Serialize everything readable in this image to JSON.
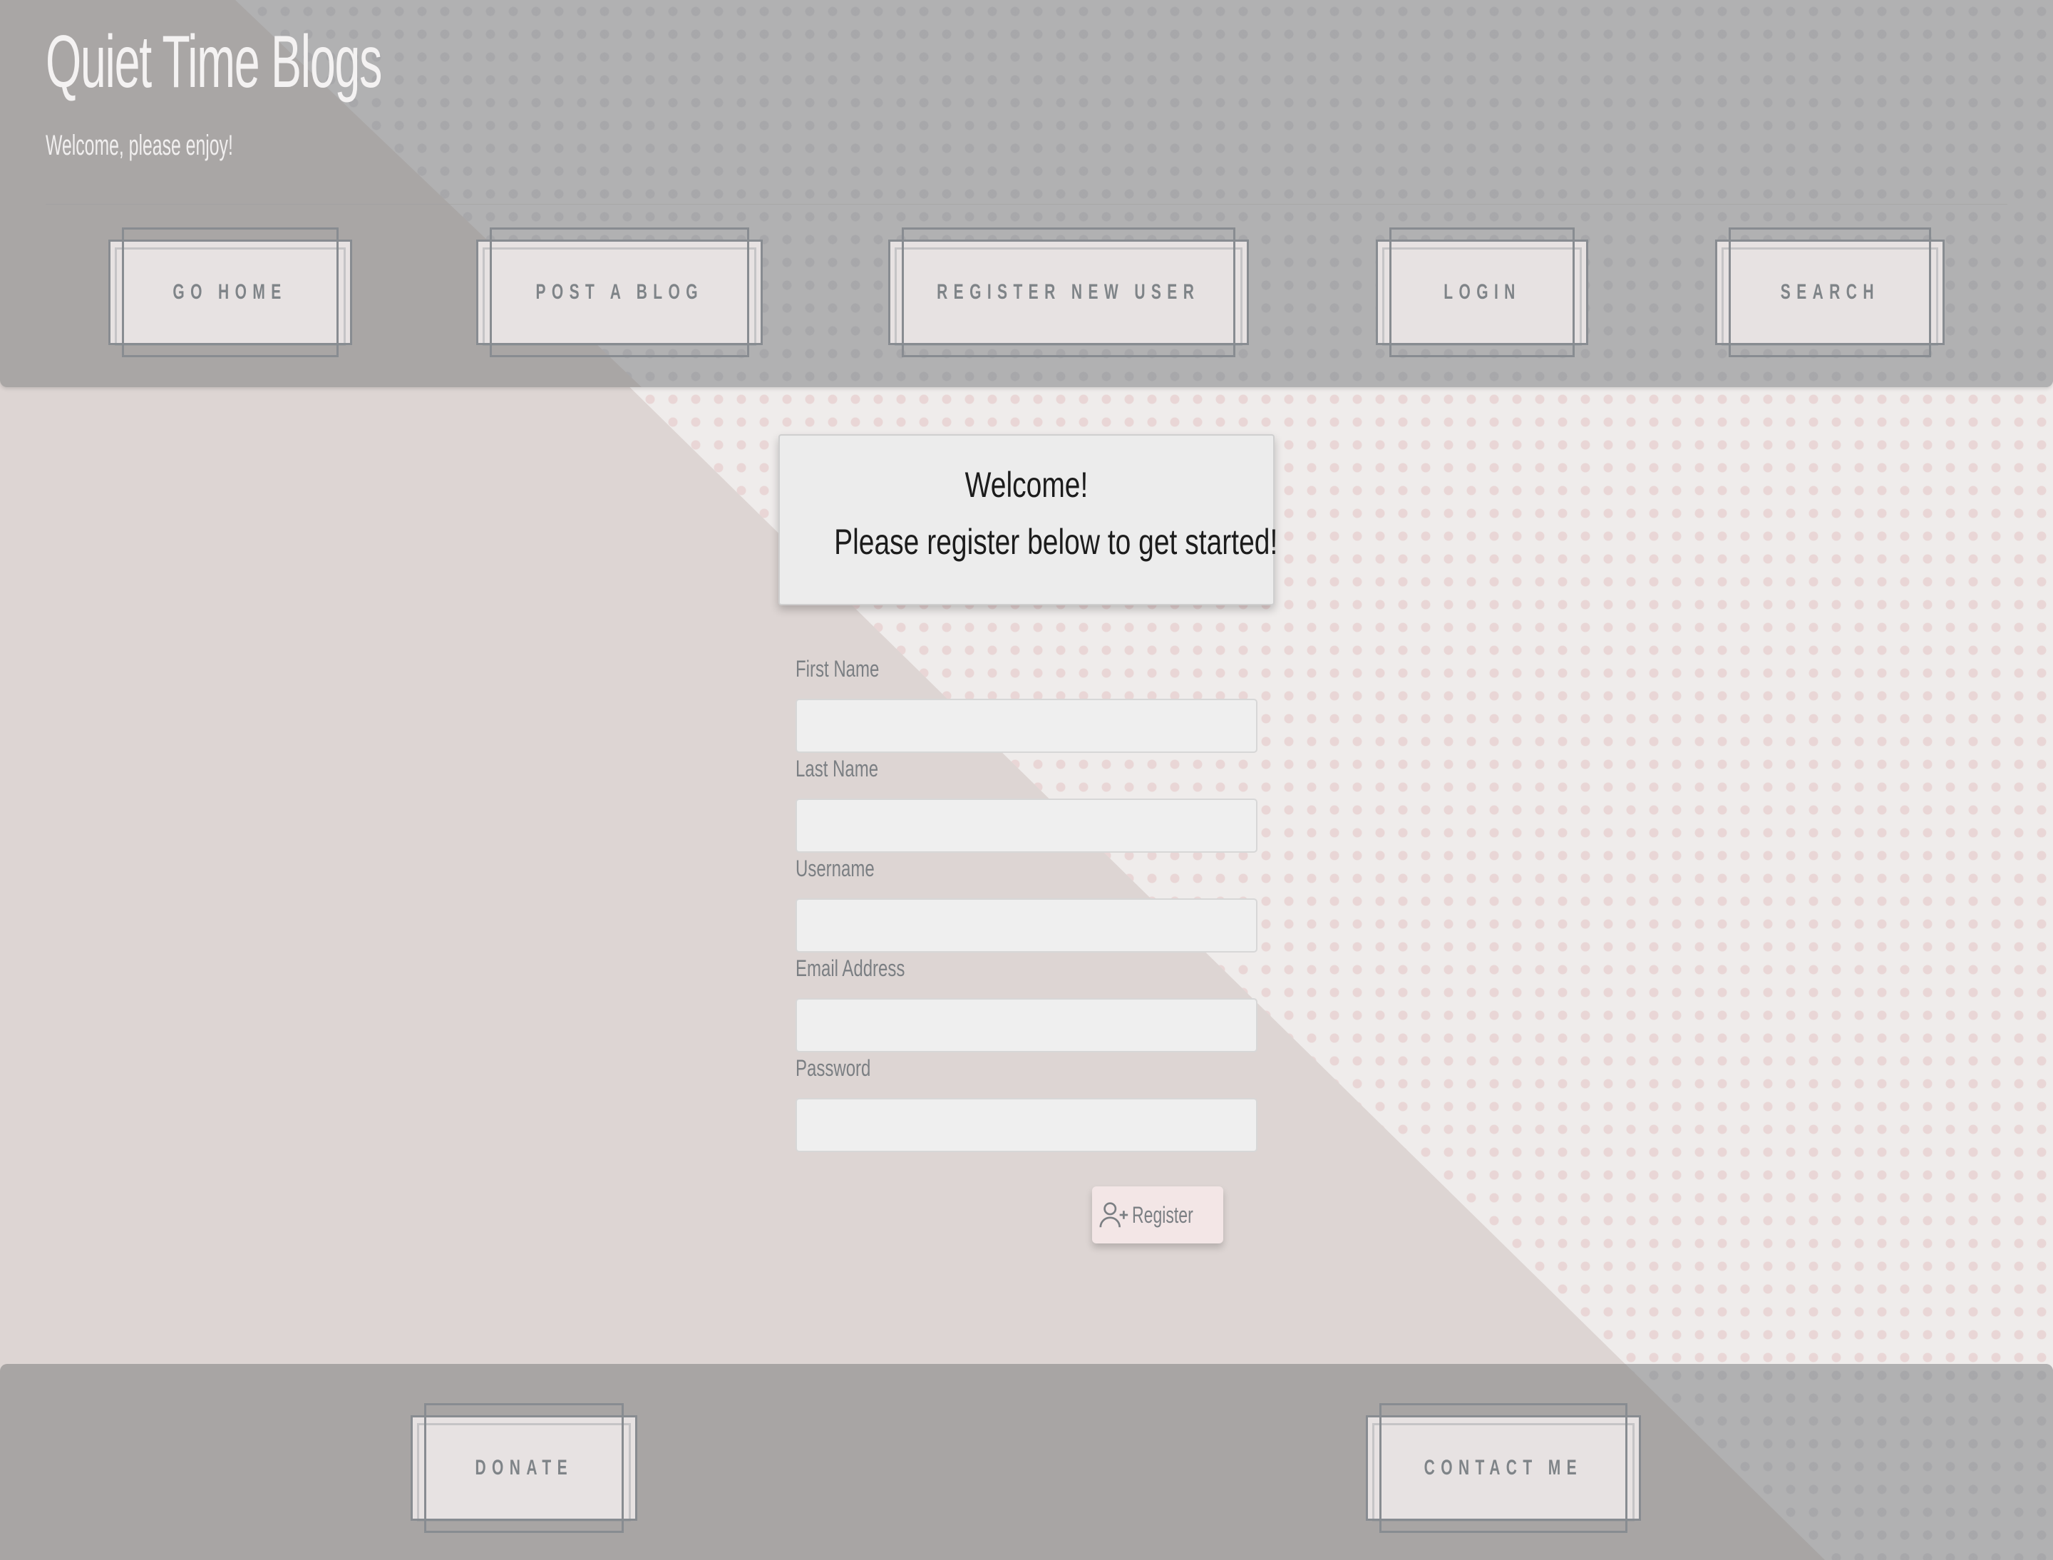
{
  "header": {
    "title": "Quiet Time Blogs",
    "subtitle": "Welcome, please enjoy!",
    "nav": [
      {
        "label": "GO HOME"
      },
      {
        "label": "POST A BLOG"
      },
      {
        "label": "REGISTER NEW USER"
      },
      {
        "label": "LOGIN"
      },
      {
        "label": "SEARCH"
      }
    ]
  },
  "welcome": {
    "line1": "Welcome!",
    "line2": "Please register below to get started!"
  },
  "form": {
    "fields": [
      {
        "label": "First Name",
        "value": ""
      },
      {
        "label": "Last Name",
        "value": ""
      },
      {
        "label": "Username",
        "value": ""
      },
      {
        "label": "Email Address",
        "value": ""
      },
      {
        "label": "Password",
        "value": ""
      }
    ],
    "submit_label": "Register",
    "submit_icon": "user-plus-icon"
  },
  "footer": {
    "nav": [
      {
        "label": "DONATE"
      },
      {
        "label": "CONTACT ME"
      }
    ]
  },
  "colors": {
    "header_bg": "#a9a6a5",
    "page_bg": "#ddd5d3",
    "button_bg": "#e7e2e2",
    "button_border": "#888c91",
    "button_text": "#7f8488",
    "register_bg": "#f3e6e6"
  }
}
